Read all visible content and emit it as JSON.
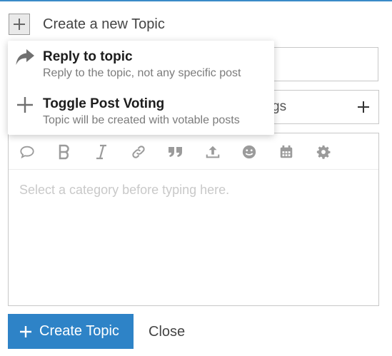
{
  "header": {
    "title": "Create a new Topic",
    "toggle_icon": "plus-icon"
  },
  "fields": {
    "tags_partial_text": "gs"
  },
  "composer": {
    "toolbar": [
      "quote-icon",
      "bold-icon",
      "italic-icon",
      "link-icon",
      "blockquote-icon",
      "upload-icon",
      "emoji-icon",
      "calendar-icon",
      "gear-icon"
    ],
    "placeholder": "Select a category before typing here."
  },
  "dropdown": {
    "items": [
      {
        "icon": "reply-icon",
        "title": "Reply to topic",
        "description": "Reply to the topic, not any specific post"
      },
      {
        "icon": "plus-icon",
        "title": "Toggle Post Voting",
        "description": "Topic will be created with votable posts"
      }
    ]
  },
  "footer": {
    "create_label": "Create Topic",
    "close_label": "Close"
  },
  "colors": {
    "accent": "#2e83c7",
    "top_border": "#3a8ac8",
    "icon_gray": "#9b9b9b"
  }
}
